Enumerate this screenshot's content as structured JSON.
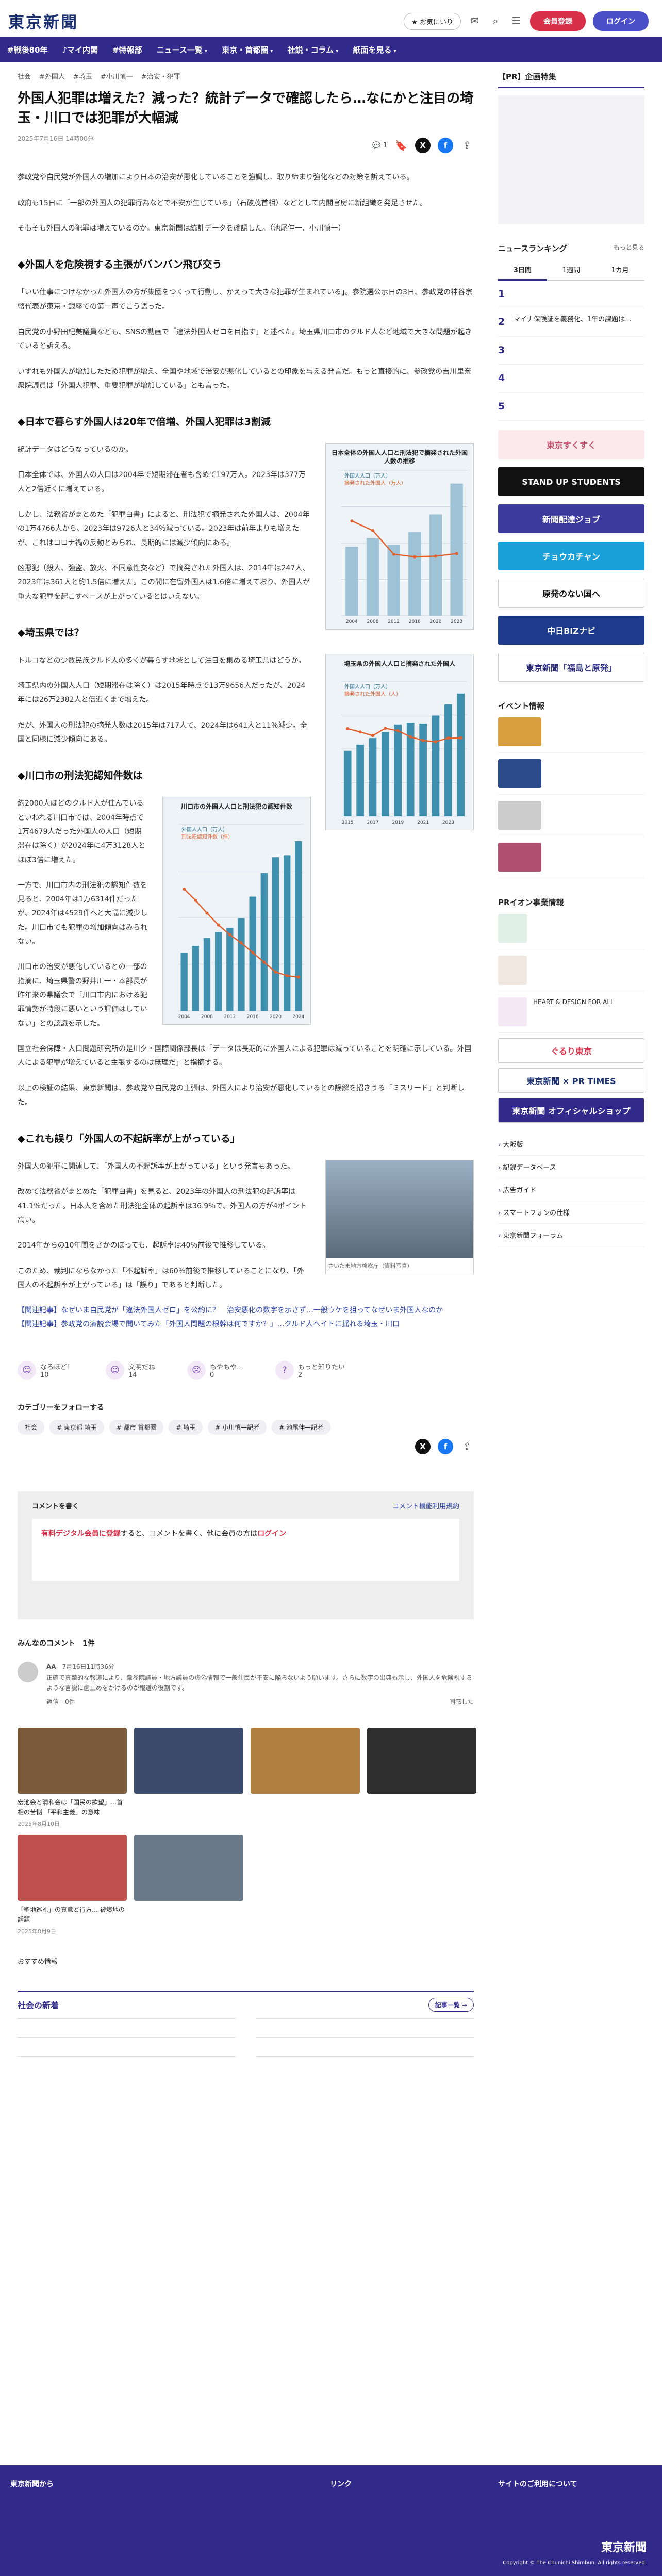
{
  "header": {
    "logo": "東京新聞",
    "nav_pill": "お気にいり",
    "login_free": "会員登録",
    "login": "ログイン"
  },
  "nav": [
    "#戦後80年",
    "♪マイ内閣",
    "#特報部",
    "ニュース一覧",
    "東京・首都圏",
    "社説・コラム",
    "紙面を見る"
  ],
  "article": {
    "tags": [
      "社会",
      "#外国人",
      "#埼玉",
      "#小川慎一",
      "#治安・犯罪"
    ],
    "title": "外国人犯罪は増えた？減った？統計データで確認したら…なにかと注目の埼玉・川口では犯罪が大幅減",
    "date": "2025年7月16日 14時00分",
    "comment_count": "1",
    "share": [
      "X",
      "f"
    ],
    "body": [
      {
        "h": "",
        "p": [
          "参政党や自民党が外国人の増加により日本の治安が悪化していることを強調し、取り締まり強化などの対策を訴えている。",
          "政府も15日に「一部の外国人の犯罪行為などで不安が生じている」（石破茂首相）などとして内閣官房に新組織を発足させた。",
          "そもそも外国人の犯罪は増えているのか。東京新聞は統計データを確認した。（池尾伸一、小川慎一）"
        ]
      },
      {
        "h": "◆外国人を危険視する主張がバンバン飛び交う",
        "p": [
          "「いい仕事につけなかった外国人の方が集団をつくって行動し、かえって大きな犯罪が生まれている」。参院選公示日の3日、参政党の神谷宗幣代表が東京・銀座での第一声でこう語った。",
          "自民党の小野田紀美議員なども、SNSの動画で「違法外国人ゼロを目指す」と述べた。埼玉県川口市のクルド人など地域で大きな問題が起きていると訴える。",
          "いずれも外国人が増加したため犯罪が増え、全国や地域で治安が悪化しているとの印象を与える発言だ。もっと直接的に、参政党の吉川里奈衆院議員は「外国人犯罪、重要犯罪が増加している」とも言った。"
        ]
      },
      {
        "h": "◆日本で暮らす外国人は20年で倍増、外国人犯罪は3割減",
        "p": [
          "統計データはどうなっているのか。",
          "日本全体では、外国人の人口は2004年で短期滞在者も含めて197万人。2023年は377万人と2倍近くに増えている。",
          "しかし、法務省がまとめた「犯罪白書」によると、刑法犯で摘発された外国人は、2004年の1万4766人から、2023年は9726人と34％減っている。2023年は前年よりも増えたが、これはコロナ禍の反動とみられ、長期的には減少傾向にある。",
          "凶悪犯（殺人、強盗、放火、不同意性交など）で摘発された外国人は、2014年は247人、2023年は361人と約1.5倍に増えた。この間に在留外国人は1.6倍に増えており、外国人が重大な犯罪を起こすペースが上がっているとはいえない。"
        ]
      },
      {
        "h": "◆埼玉県では？",
        "p": [
          "トルコなどの少数民族クルド人の多くが暮らす地域として注目を集める埼玉県はどうか。",
          "埼玉県内の外国人人口（短期滞在は除く）は2015年時点で13万9656人だったが、2024年には26万2382人と倍近くまで増えた。",
          "だが、外国人の刑法犯の摘発人数は2015年は717人で、2024年は641人と11％減少。全国と同様に減少傾向にある。"
        ]
      },
      {
        "h": "◆川口市の刑法犯認知件数は",
        "p": [
          "約2000人ほどのクルド人が住んでいるといわれる川口市では、2004年時点で1万4679人だった外国人の人口（短期滞在は除く）が2024年に4万3128人とほぼ3倍に増えた。",
          "一方で、川口市内の刑法犯の認知件数を見ると、2004年は1万6314件だったが、2024年は4529件へと大幅に減少した。川口市でも犯罪の増加傾向はみられない。",
          "川口市の治安が悪化しているとの一部の指摘に、埼玉県警の野井川一・本部長が昨年来の県議会で「川口市内における犯罪情勢が特段に悪いという評価はしていない」との認識を示した。",
          "国立社会保障・人口問題研究所の是川夕・国際関係部長は「データは長期的に外国人による犯罪は減っていることを明確に示している。外国人による犯罪が増えていると主張するのは無理だ」と指摘する。",
          "以上の検証の結果、東京新聞は、参政党や自民党の主張は、外国人により治安が悪化しているとの誤解を招きうる「ミスリード」と判断した。"
        ]
      },
      {
        "h": "◆これも誤り「外国人の不起訴率が上がっている」",
        "p": [
          "外国人の犯罪に関連して、「外国人の不起訴率が上がっている」という発言もあった。",
          "改めて法務省がまとめた「犯罪白書」を見ると、2023年の外国人の刑法犯の起訴率は41.1％だった。日本人を含めた刑法犯全体の起訴率は36.9％で、外国人の方が4ポイント高い。",
          "2014年からの10年間をさかのぼっても、起訴率は40％前後で推移している。",
          "このため、裁判にならなかった「不起訴率」は60％前後で推移していることになり、「外国人の不起訴率が上がっている」は「誤り」であると判断した。"
        ]
      }
    ],
    "related": [
      "【関連記事】なぜいま自民党が「違法外国人ゼロ」を公約に？　治安悪化の数字を示さず…一般ウケを狙ってなぜいま外国人なのか",
      "【関連記事】参政党の演説会場で聞いてみた「外国人問題の根幹は何ですか？」…クルド人ヘイトに揺れる埼玉・川口"
    ],
    "reactions": [
      {
        "label": "なるほど！",
        "count": "10"
      },
      {
        "label": "文明だね",
        "count": "14"
      },
      {
        "label": "もやもや…",
        "count": "0"
      },
      {
        "label": "もっと知りたい",
        "count": "2"
      }
    ],
    "category_heading": "カテゴリーをフォローする",
    "category_tags": [
      "社会",
      "# 東京都 埼玉",
      "# 都市 首都圏",
      "# 埼玉",
      "# 小川慎一記者",
      "# 池尾伸一記者"
    ],
    "photo_caption": "さいたま地方検察庁（資料写真）"
  },
  "charts": [
    {
      "type": "area",
      "title": "日本全体の外国人人口と刑法犯で摘発された外国人数の推移",
      "xlabel": "",
      "ylabel": "",
      "x": [
        "2004",
        "2008",
        "2012",
        "2016",
        "2020",
        "2023"
      ],
      "series": [
        {
          "name": "外国人人口（万人）",
          "values": [
            197,
            221,
            203,
            238,
            289,
            377
          ]
        },
        {
          "name": "摘発された外国人（万人）",
          "values": [
            1.48,
            1.33,
            0.96,
            0.92,
            0.93,
            0.97
          ]
        }
      ]
    },
    {
      "type": "bar",
      "title": "埼玉県の外国人人口と摘発された外国人",
      "xlabel": "",
      "ylabel": "",
      "x": [
        "2015",
        "2016",
        "2017",
        "2018",
        "2019",
        "2020",
        "2021",
        "2022",
        "2023",
        "2024"
      ],
      "series": [
        {
          "name": "外国人人口（万人）",
          "values": [
            14.0,
            15.3,
            16.7,
            18.0,
            19.6,
            20.0,
            19.8,
            21.5,
            23.9,
            26.2
          ]
        },
        {
          "name": "摘発された外国人（人）",
          "values": [
            717,
            690,
            660,
            720,
            700,
            650,
            620,
            610,
            640,
            641
          ]
        }
      ]
    },
    {
      "type": "bar",
      "title": "川口市の外国人人口と刑法犯の認知件数",
      "xlabel": "",
      "ylabel": "",
      "x": [
        "2004",
        "2006",
        "2008",
        "2010",
        "2012",
        "2014",
        "2016",
        "2018",
        "2020",
        "2022",
        "2024"
      ],
      "series": [
        {
          "name": "外国人人口（万人）",
          "values": [
            1.47,
            1.65,
            1.85,
            2.0,
            2.1,
            2.35,
            2.9,
            3.5,
            3.9,
            3.95,
            4.31
          ]
        },
        {
          "name": "刑法犯認知件数（件）",
          "values": [
            16314,
            14800,
            13100,
            11500,
            10200,
            9100,
            7800,
            6500,
            5200,
            4700,
            4529
          ]
        }
      ]
    }
  ],
  "comments": {
    "box_heading": "コメントを書く",
    "box_link": "コメント機能利用規約",
    "box_text_a": "有料デジタル会員に登録",
    "box_text_b": "すると、コメントを書く、他に会員の方は",
    "box_login": "ログイン",
    "heading": "みんなのコメント",
    "count": "1件",
    "user": "AA",
    "date": "7月16日11時36分",
    "text": "正確で真摯的な報道により、衆参院議員・地方議員の虚偽情報で一般住民が不安に陥らないよう願います。さらに数字の出典も示し、外国人を危険視するような言説に歯止めをかけるのが報道の役割です。",
    "reply": "返信　0件",
    "like": "同感した"
  },
  "cards": [
    {
      "title": "宏池会と清和会は「国民の欲望」…首相の苦悩 「平和主義」の意味",
      "date": "2025年8月10日"
    },
    {
      "title": "",
      "date": ""
    },
    {
      "title": "",
      "date": ""
    },
    {
      "title": "",
      "date": ""
    },
    {
      "title": "「聖地巡礼」の真意と行方… 被爆地の話題",
      "date": "2025年8月9日"
    },
    {
      "title": "",
      "date": ""
    }
  ],
  "recommend": "おすすめ情報",
  "social": {
    "heading": "社会の新着",
    "more": "記事一覧 →",
    "items": [
      {
        "title": "",
        "body": "",
        "date": ""
      },
      {
        "title": "",
        "body": "",
        "date": ""
      },
      {
        "title": "",
        "body": "",
        "date": ""
      },
      {
        "title": "",
        "body": "",
        "date": ""
      },
      {
        "title": "",
        "body": "",
        "date": ""
      },
      {
        "title": "",
        "body": "",
        "date": ""
      }
    ]
  },
  "side": {
    "pr": "【PR】企画特集",
    "ranking": "ニュースランキング",
    "ranking_more": "もっと見る",
    "tabs": [
      "3日間",
      "1週間",
      "1カ月"
    ],
    "rank": [
      {
        "n": "1",
        "t": ""
      },
      {
        "n": "2",
        "t": "マイナ保険証を義務化、1年の課題は…"
      },
      {
        "n": "3",
        "t": ""
      },
      {
        "n": "4",
        "t": ""
      },
      {
        "n": "5",
        "t": ""
      }
    ],
    "banners": [
      "東京すくすく",
      "STAND UP STUDENTS",
      "新聞配達ジョブ",
      "チョウカチャン",
      "原発のない国へ",
      "中日BIZナビ",
      "東京新聞「福島と原発」"
    ],
    "events_h": "イベント情報",
    "events": [
      {
        "t": "",
        "d": ""
      },
      {
        "t": "",
        "d": ""
      },
      {
        "t": "",
        "d": ""
      },
      {
        "t": "",
        "d": ""
      }
    ],
    "pr2": "PRイオン事業情報",
    "pr_items": [
      {
        "t": "",
        "d": ""
      },
      {
        "t": "",
        "d": ""
      },
      {
        "t": "HEART & DESIGN FOR ALL",
        "d": ""
      }
    ],
    "small_banners": [
      "ぐるり東京",
      "東京新聞 × PR TIMES",
      "東京新聞 オフィシャルショップ"
    ],
    "links": [
      "大阪版",
      "記録データベース",
      "広告ガイド",
      "スマートフォンの仕様",
      "東京新聞フォーラム"
    ]
  },
  "footer": {
    "cols": [
      {
        "h": "東京新聞から",
        "items": [
          "",
          "",
          "",
          "",
          ""
        ]
      },
      {
        "h": "",
        "items": [
          "",
          "",
          "",
          "",
          ""
        ]
      },
      {
        "h": "",
        "items": [
          "",
          "",
          "",
          "",
          ""
        ]
      },
      {
        "h": "リンク",
        "items": [
          "",
          "",
          "",
          ""
        ]
      },
      {
        "h": "サイトのご利用について",
        "items": [
          "",
          "",
          "",
          ""
        ]
      }
    ],
    "logo": "東京新聞",
    "copy": "Copyright © The Chunichi Shimbun, All rights reserved."
  }
}
